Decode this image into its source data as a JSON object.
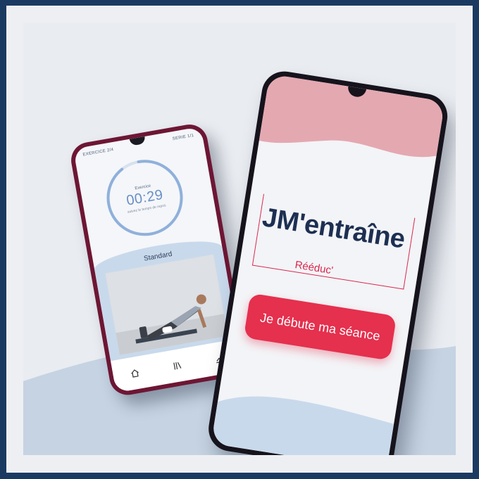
{
  "colors": {
    "outer_background": "#1b3a62",
    "scene_background": "#e9ecf1",
    "accent_red": "#e5304e",
    "brand_navy": "#1d2f52",
    "soft_pink": "#e4a8b1",
    "soft_blue": "#c9d9ec",
    "phone_left_body": "#6d1634",
    "phone_right_body": "#16131c"
  },
  "left_phone": {
    "status_left": "EXERCICE 2/4",
    "status_right": "SERIE 1/1",
    "timer": {
      "label": "Exercice",
      "time": "00:29",
      "sub": "suivez le temps de repos",
      "progress_fraction": 0.92
    },
    "section_title": "Standard",
    "nav_icons": [
      "home-icon",
      "library-icon",
      "progress-chart-icon"
    ]
  },
  "right_phone": {
    "logo": {
      "main": "JM'entraîne",
      "sub": "Rééduc'"
    },
    "cta_label": "Je débute ma séance"
  }
}
